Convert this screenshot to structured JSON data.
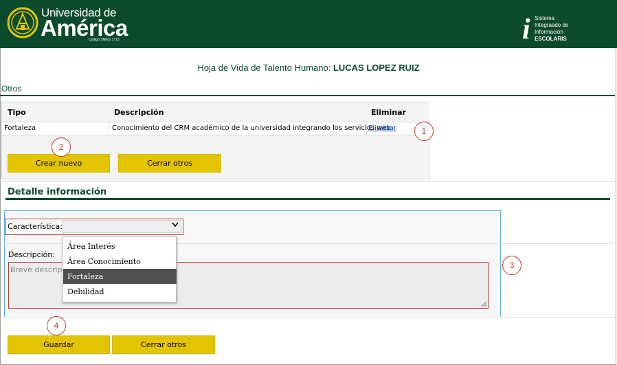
{
  "header": {
    "logo_line1": "Universidad de",
    "logo_line2": "América",
    "logo_codigo": "Código SNIES 1715",
    "system_line1": "Sistema",
    "system_line2": "Integraado de",
    "system_line3": "Información",
    "system_line4": "ESCOLARIS",
    "brand_color": "#0b4a2c"
  },
  "page": {
    "title_prefix": "Hoja de Vida de Talento Humano: ",
    "title_name": "LUCAS LOPEZ RUIZ",
    "section": "Otros"
  },
  "table": {
    "columns": [
      "Tipo",
      "Descripción",
      "Eliminar"
    ],
    "rows": [
      {
        "tipo": "Fortaleza",
        "descripcion": "Conocimiento del CRM académico de la universidad integrando los servicios web",
        "eliminar": "Eliminar"
      }
    ]
  },
  "buttons": {
    "crear_nuevo": "Crear nuevo",
    "cerrar_otros_top": "Cerrar otros",
    "guardar": "Guardar",
    "cerrar_otros_bottom": "Cerrar otros",
    "accent": "#e3c400"
  },
  "detail": {
    "heading": "Detalle información",
    "caracteristica_label": "Característica:",
    "caracteristica_value": "",
    "descripcion_label": "Descripción:",
    "descripcion_placeholder": "Breve descripci",
    "options": [
      "Área Interés",
      "Área Conocimiento",
      "Fortaleza",
      "Debilidad"
    ],
    "highlighted_option": "Fortaleza"
  },
  "annotations": [
    "1",
    "2",
    "3",
    "4"
  ]
}
